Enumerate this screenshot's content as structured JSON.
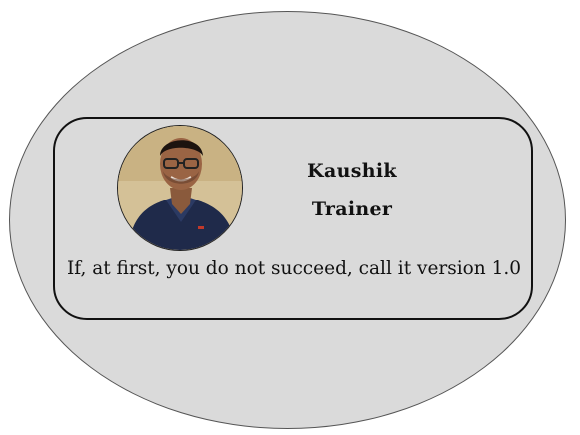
{
  "profile": {
    "name": "Kaushik",
    "role": "Trainer",
    "quote": "If, at first, you do not succeed, call it version 1.0",
    "photo_icon": "person-photo"
  },
  "colors": {
    "background_oval": "#dadada",
    "card_border": "#111111",
    "text": "#111111"
  }
}
